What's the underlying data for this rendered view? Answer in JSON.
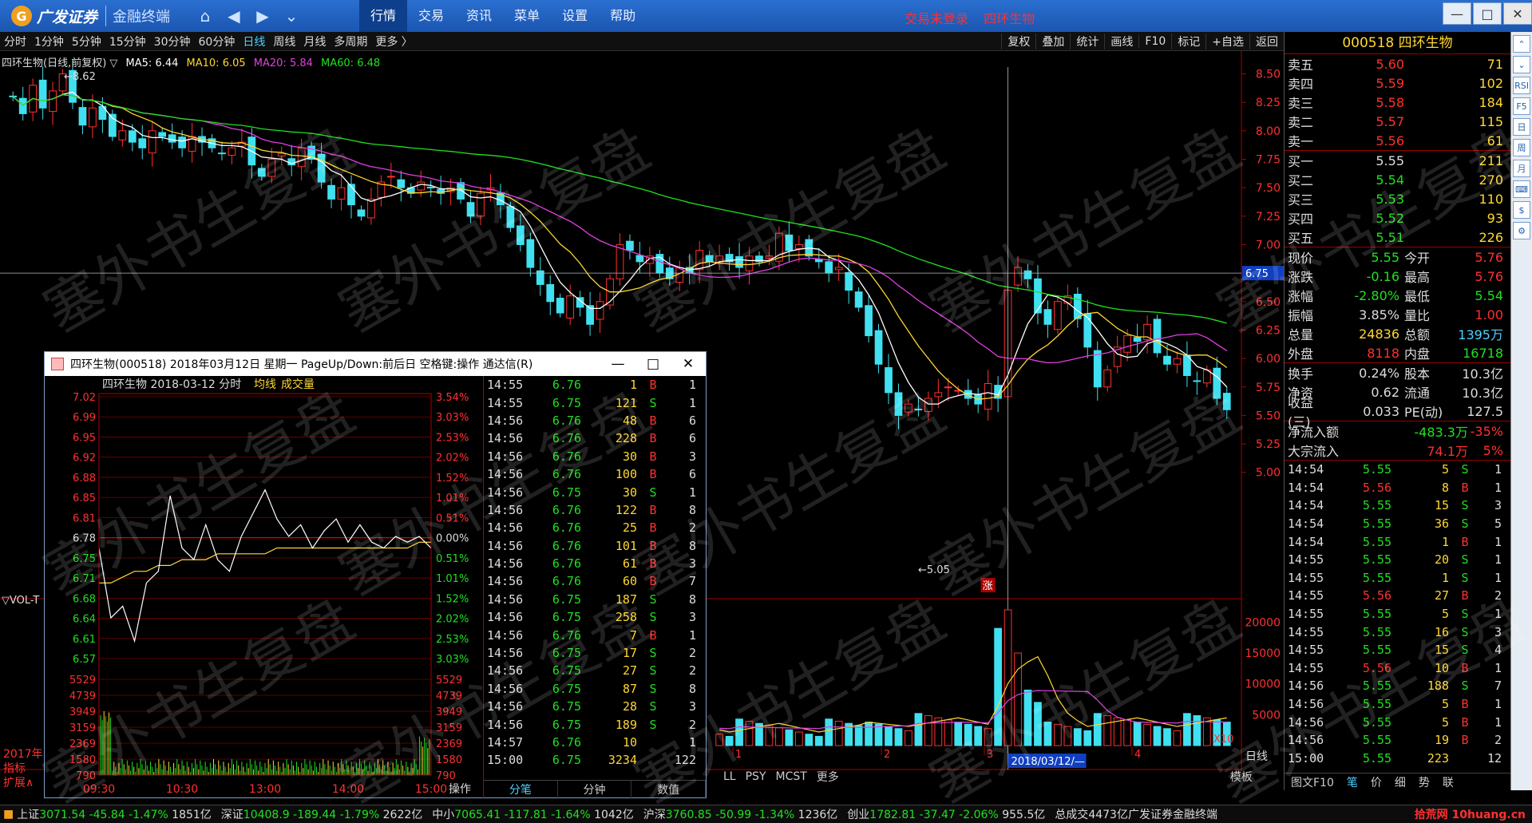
{
  "app": {
    "brand": "广发证券",
    "subtitle": "金融终端"
  },
  "mainmenu": [
    {
      "label": "行情",
      "active": true
    },
    {
      "label": "交易",
      "active": false
    },
    {
      "label": "资讯",
      "active": false
    },
    {
      "label": "菜单",
      "active": false
    },
    {
      "label": "设置",
      "active": false
    },
    {
      "label": "帮助",
      "active": false
    }
  ],
  "trade_alert": {
    "status": "交易未登录",
    "stock": "四环生物"
  },
  "periods": [
    {
      "label": "分时",
      "active": false
    },
    {
      "label": "1分钟",
      "active": false
    },
    {
      "label": "5分钟",
      "active": false
    },
    {
      "label": "15分钟",
      "active": false
    },
    {
      "label": "30分钟",
      "active": false
    },
    {
      "label": "60分钟",
      "active": false
    },
    {
      "label": "日线",
      "active": true
    },
    {
      "label": "周线",
      "active": false
    },
    {
      "label": "月线",
      "active": false
    },
    {
      "label": "多周期",
      "active": false
    },
    {
      "label": "更多 〉",
      "active": false
    }
  ],
  "tools": [
    "复权",
    "叠加",
    "统计",
    "画线",
    "F10",
    "标记",
    "+自选",
    "返回"
  ],
  "chart": {
    "title": "四环生物(日线,前复权) ▽",
    "ma": [
      {
        "label": "MA5: 6.44",
        "color": "#ffffff"
      },
      {
        "label": "MA10: 6.05",
        "color": "#ffd830"
      },
      {
        "label": "MA20: 5.84",
        "color": "#e040e0"
      },
      {
        "label": "MA60: 6.48",
        "color": "#20e020"
      }
    ],
    "high_label": "8.62",
    "low_label": "5.05",
    "crosshair_price": "6.75",
    "crosshair_date": "2018/03/12/—",
    "zhang_badge": "涨",
    "x10_label": "X10",
    "vol_label": "▽VOL-T",
    "y_ticks": [
      "8.50",
      "8.25",
      "8.00",
      "7.75",
      "7.50",
      "7.25",
      "7.00",
      "6.75",
      "6.50",
      "6.25",
      "6.00",
      "5.75",
      "5.50",
      "5.25",
      "5.00"
    ],
    "vol_ticks": [
      "20000",
      "15000",
      "10000",
      "5000"
    ],
    "month_ticks": [
      "1",
      "2",
      "3",
      "4"
    ],
    "side_labels": [
      "2017年",
      "指标",
      "扩展∧"
    ],
    "period_label": "日线",
    "colors": {
      "up": "#ff3030",
      "down": "#40e0f0",
      "ma5": "#ffffff",
      "ma10": "#ffd830",
      "ma20": "#e040e0",
      "ma60": "#20e020"
    }
  },
  "chart_data": {
    "type": "candlestick",
    "title": "四环生物(日线,前复权)",
    "ylim": [
      4.9,
      8.7
    ],
    "closes": [
      8.3,
      8.15,
      8.4,
      8.2,
      8.35,
      8.5,
      8.25,
      8.05,
      8.2,
      8.1,
      7.95,
      8.0,
      7.9,
      7.85,
      8.0,
      7.95,
      7.9,
      7.85,
      7.95,
      7.9,
      7.85,
      7.8,
      7.85,
      7.9,
      7.7,
      7.6,
      7.75,
      7.8,
      7.7,
      7.85,
      7.75,
      7.55,
      7.4,
      7.5,
      7.35,
      7.25,
      7.4,
      7.55,
      7.6,
      7.5,
      7.45,
      7.55,
      7.5,
      7.45,
      7.5,
      7.4,
      7.25,
      7.45,
      7.5,
      7.35,
      7.15,
      7.0,
      6.8,
      6.65,
      6.5,
      6.4,
      6.55,
      6.45,
      6.3,
      6.5,
      6.7,
      7.0,
      6.95,
      6.85,
      6.9,
      6.75,
      6.7,
      6.8,
      6.75,
      6.95,
      6.85,
      6.9,
      6.85,
      6.8,
      6.9,
      6.85,
      6.9,
      7.1,
      6.95,
      7.0,
      6.9,
      6.85,
      6.75,
      6.8,
      6.6,
      6.45,
      6.2,
      5.95,
      5.7,
      5.5,
      5.6,
      5.55,
      5.65,
      5.7,
      5.75,
      5.72,
      5.65,
      5.6,
      5.78,
      5.65,
      6.6,
      6.8,
      6.7,
      6.4,
      6.3,
      6.5,
      6.55,
      6.35,
      6.1,
      5.75,
      5.9,
      6.1,
      6.2,
      6.15,
      6.3,
      6.05,
      5.95,
      6.0,
      5.85,
      5.8,
      5.9,
      5.65,
      5.55
    ],
    "volume_scale": [
      0,
      22000
    ],
    "intraday": {
      "title": "四环生物",
      "date": "2018-03-12 分时",
      "legend": [
        "均线",
        "成交量"
      ],
      "prev_close": 6.78,
      "price_ticks": [
        "7.02",
        "6.99",
        "6.95",
        "6.92",
        "6.88",
        "6.85",
        "6.81",
        "6.78",
        "6.75",
        "6.71",
        "6.68",
        "6.64",
        "6.61",
        "6.57"
      ],
      "pct_ticks": [
        "3.54%",
        "3.03%",
        "2.53%",
        "2.02%",
        "1.52%",
        "1.01%",
        "0.51%",
        "0.00%",
        "0.51%",
        "1.01%",
        "1.52%",
        "2.02%",
        "2.53%",
        "3.03%"
      ],
      "vol_ticks": [
        "5529",
        "4739",
        "3949",
        "3159",
        "2369",
        "1580",
        "790"
      ],
      "time_ticks": [
        "09:30",
        "10:30",
        "13:00",
        "14:00",
        "15:00"
      ],
      "prices": [
        6.76,
        6.64,
        6.66,
        6.6,
        6.7,
        6.72,
        6.85,
        6.76,
        6.74,
        6.8,
        6.74,
        6.72,
        6.78,
        6.82,
        6.86,
        6.81,
        6.78,
        6.8,
        6.76,
        6.79,
        6.81,
        6.77,
        6.8,
        6.77,
        6.76,
        6.78,
        6.77,
        6.78,
        6.76
      ],
      "avg": [
        6.7,
        6.7,
        6.71,
        6.72,
        6.72,
        6.73,
        6.73,
        6.74,
        6.74,
        6.74,
        6.75,
        6.75,
        6.75,
        6.75,
        6.75,
        6.76,
        6.76,
        6.76,
        6.76,
        6.76,
        6.76,
        6.76,
        6.76,
        6.76,
        6.76,
        6.76,
        6.76,
        6.77,
        6.77
      ]
    }
  },
  "popup": {
    "title": "四环生物(000518) 2018年03月12日 星期一 PageUp/Down:前后日 空格键:操作 通达信(R)",
    "action_label": "操作",
    "tick_tabs": [
      "分笔",
      "分钟",
      "数值"
    ],
    "ticks": [
      [
        "14:55",
        "6.76",
        "1",
        "B",
        "1"
      ],
      [
        "14:55",
        "6.75",
        "121",
        "S",
        "1"
      ],
      [
        "14:56",
        "6.76",
        "48",
        "B",
        "6"
      ],
      [
        "14:56",
        "6.76",
        "228",
        "B",
        "6"
      ],
      [
        "14:56",
        "6.76",
        "30",
        "B",
        "3"
      ],
      [
        "14:56",
        "6.76",
        "100",
        "B",
        "6"
      ],
      [
        "14:56",
        "6.75",
        "30",
        "S",
        "1"
      ],
      [
        "14:56",
        "6.76",
        "122",
        "B",
        "8"
      ],
      [
        "14:56",
        "6.76",
        "25",
        "B",
        "2"
      ],
      [
        "14:56",
        "6.76",
        "101",
        "B",
        "8"
      ],
      [
        "14:56",
        "6.76",
        "61",
        "B",
        "3"
      ],
      [
        "14:56",
        "6.76",
        "60",
        "B",
        "7"
      ],
      [
        "14:56",
        "6.75",
        "187",
        "S",
        "8"
      ],
      [
        "14:56",
        "6.75",
        "258",
        "S",
        "3"
      ],
      [
        "14:56",
        "6.76",
        "7",
        "B",
        "1"
      ],
      [
        "14:56",
        "6.75",
        "17",
        "S",
        "2"
      ],
      [
        "14:56",
        "6.75",
        "27",
        "S",
        "2"
      ],
      [
        "14:56",
        "6.75",
        "87",
        "S",
        "8"
      ],
      [
        "14:56",
        "6.75",
        "28",
        "S",
        "3"
      ],
      [
        "14:56",
        "6.75",
        "189",
        "S",
        "2"
      ],
      [
        "14:57",
        "6.76",
        "10",
        "",
        "1"
      ],
      [
        "15:00",
        "6.75",
        "3234",
        "",
        "122"
      ]
    ]
  },
  "rpanel": {
    "title": "000518 四环生物",
    "sell": [
      [
        "卖五",
        "5.60",
        "71"
      ],
      [
        "卖四",
        "5.59",
        "102"
      ],
      [
        "卖三",
        "5.58",
        "184"
      ],
      [
        "卖二",
        "5.57",
        "115"
      ],
      [
        "卖一",
        "5.56",
        "61"
      ]
    ],
    "buy": [
      [
        "买一",
        "5.55",
        "211"
      ],
      [
        "买二",
        "5.54",
        "270"
      ],
      [
        "买三",
        "5.53",
        "110"
      ],
      [
        "买四",
        "5.52",
        "93"
      ],
      [
        "买五",
        "5.51",
        "226"
      ]
    ],
    "stats": [
      [
        "现价",
        "5.55",
        "g",
        "今开",
        "5.76",
        "r"
      ],
      [
        "涨跌",
        "-0.16",
        "g",
        "最高",
        "5.76",
        "r"
      ],
      [
        "涨幅",
        "-2.80%",
        "g",
        "最低",
        "5.54",
        "g"
      ],
      [
        "振幅",
        "3.85%",
        "w",
        "量比",
        "1.00",
        "r"
      ],
      [
        "总量",
        "24836",
        "y",
        "总额",
        "1395万",
        "c"
      ],
      [
        "外盘",
        "8118",
        "r",
        "内盘",
        "16718",
        "g"
      ]
    ],
    "stats2": [
      [
        "换手",
        "0.24%",
        "w",
        "股本",
        "10.3亿",
        "w"
      ],
      [
        "净资",
        "0.62",
        "w",
        "流通",
        "10.3亿",
        "w"
      ],
      [
        "收益(三)",
        "0.033",
        "w",
        "PE(动)",
        "127.5",
        "w"
      ]
    ],
    "flow": [
      [
        "净流入额",
        "-483.3万",
        "-35%"
      ],
      [
        "大宗流入",
        "74.1万",
        "5%"
      ]
    ],
    "ticks": [
      [
        "14:54",
        "5.55",
        "5",
        "S",
        "1"
      ],
      [
        "14:54",
        "5.56",
        "8",
        "B",
        "1"
      ],
      [
        "14:54",
        "5.55",
        "15",
        "S",
        "3"
      ],
      [
        "14:54",
        "5.55",
        "36",
        "S",
        "5"
      ],
      [
        "14:54",
        "5.55",
        "1",
        "B",
        "1"
      ],
      [
        "14:55",
        "5.55",
        "20",
        "S",
        "1"
      ],
      [
        "14:55",
        "5.55",
        "1",
        "S",
        "1"
      ],
      [
        "14:55",
        "5.56",
        "27",
        "B",
        "2"
      ],
      [
        "14:55",
        "5.55",
        "5",
        "S",
        "1"
      ],
      [
        "14:55",
        "5.55",
        "16",
        "S",
        "3"
      ],
      [
        "14:55",
        "5.55",
        "15",
        "S",
        "4"
      ],
      [
        "14:55",
        "5.56",
        "10",
        "B",
        "1"
      ],
      [
        "14:56",
        "5.55",
        "188",
        "S",
        "7"
      ],
      [
        "14:56",
        "5.55",
        "5",
        "B",
        "1"
      ],
      [
        "14:56",
        "5.55",
        "5",
        "B",
        "1"
      ],
      [
        "14:56",
        "5.55",
        "19",
        "B",
        "2"
      ],
      [
        "15:00",
        "5.55",
        "223",
        "",
        "12"
      ]
    ],
    "bottom_tabs": [
      "图文F10",
      "笔",
      "价",
      "细",
      "势",
      "联"
    ]
  },
  "side_icons": [
    "⌃",
    "⌄",
    "RSI",
    "F5",
    "日",
    "周",
    "月",
    "⌨",
    "$",
    "⚙"
  ],
  "bottom_tabs": [
    "LL",
    "PSY",
    "MCST",
    "更多",
    "模板"
  ],
  "statusbar": [
    {
      "name": "上证",
      "val": "3071.54",
      "chg": "-45.84",
      "pct": "-1.47%",
      "amt": "1851亿"
    },
    {
      "name": "深证",
      "val": "10408.9",
      "chg": "-189.44",
      "pct": "-1.79%",
      "amt": "2622亿"
    },
    {
      "name": "中小",
      "val": "7065.41",
      "chg": "-117.81",
      "pct": "-1.64%",
      "amt": "1042亿"
    },
    {
      "name": "沪深",
      "val": "3760.85",
      "chg": "-50.99",
      "pct": "-1.34%",
      "amt": "1236亿"
    },
    {
      "name": "创业",
      "val": "1782.81",
      "chg": "-37.47",
      "pct": "-2.06%",
      "amt": "955.5亿"
    }
  ],
  "status_total_label": "总成交",
  "status_total_amount": "4473亿",
  "status_broker": "广发证券金融终端",
  "watermark": "塞外书生复盘",
  "corner_logo": "拾荒网 10huang.cn"
}
